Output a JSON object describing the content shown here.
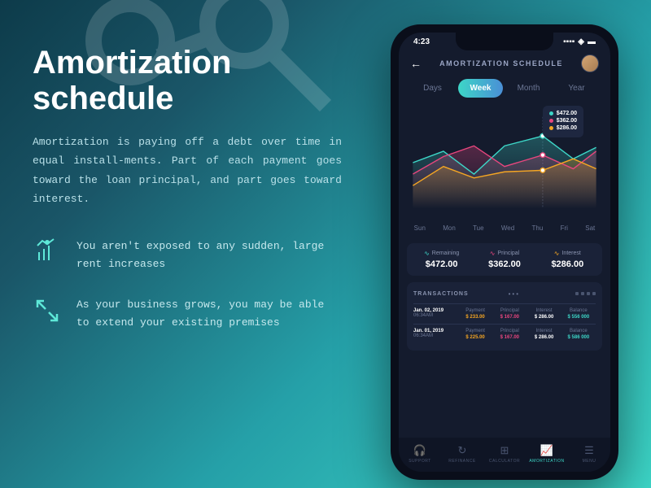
{
  "page": {
    "title": "Amortization schedule",
    "description": "Amortization is paying off a debt over time in equal install-ments. Part of each payment goes toward the loan principal, and part goes toward interest.",
    "features": [
      "You aren't exposed to any sudden, large rent increases",
      "As your business grows, you may be able to extend your existing premises"
    ]
  },
  "phone": {
    "status": {
      "time": "4:23"
    },
    "header": {
      "title": "AMORTIZATION SCHEDULE"
    },
    "tabs": [
      "Days",
      "Week",
      "Month",
      "Year"
    ],
    "tooltip": [
      "$472.00",
      "$362.00",
      "$286.00"
    ],
    "xaxis": [
      "Sun",
      "Mon",
      "Tue",
      "Wed",
      "Thu",
      "Fri",
      "Sat"
    ],
    "stats": [
      {
        "label": "Remaining",
        "value": "$472.00"
      },
      {
        "label": "Principal",
        "value": "$362.00"
      },
      {
        "label": "Interest",
        "value": "$286.00"
      }
    ],
    "transactions": {
      "title": "TRANSACTIONS",
      "rows": [
        {
          "date": "Jan. 02, 2019",
          "time": "06:34AM",
          "payment": "$ 233.00",
          "principal": "$ 167.00",
          "interest": "$ 286.00",
          "balance": "$ 556 000"
        },
        {
          "date": "Jan. 01, 2019",
          "time": "06:34AM",
          "payment": "$ 225.00",
          "principal": "$ 167.00",
          "interest": "$ 286.00",
          "balance": "$ 586 000"
        }
      ],
      "columns": [
        "Payment",
        "Principal",
        "Interest",
        "Balance"
      ]
    },
    "nav": [
      "SUPPORT",
      "REFINANCE",
      "CALCULATOR",
      "AMORTIZATION",
      "MENU"
    ]
  },
  "chart_data": {
    "type": "line",
    "categories": [
      "Sun",
      "Mon",
      "Tue",
      "Wed",
      "Thu",
      "Fri",
      "Sat"
    ],
    "series": [
      {
        "name": "Remaining",
        "color": "#3dd6c7",
        "values": [
          320,
          380,
          290,
          420,
          472,
          350,
          410
        ]
      },
      {
        "name": "Principal",
        "color": "#e8467e",
        "values": [
          260,
          340,
          400,
          310,
          362,
          300,
          380
        ]
      },
      {
        "name": "Interest",
        "color": "#f5a623",
        "values": [
          210,
          300,
          250,
          280,
          286,
          340,
          290
        ]
      }
    ],
    "ylim": [
      0,
      500
    ],
    "highlighted_x": "Thu"
  }
}
